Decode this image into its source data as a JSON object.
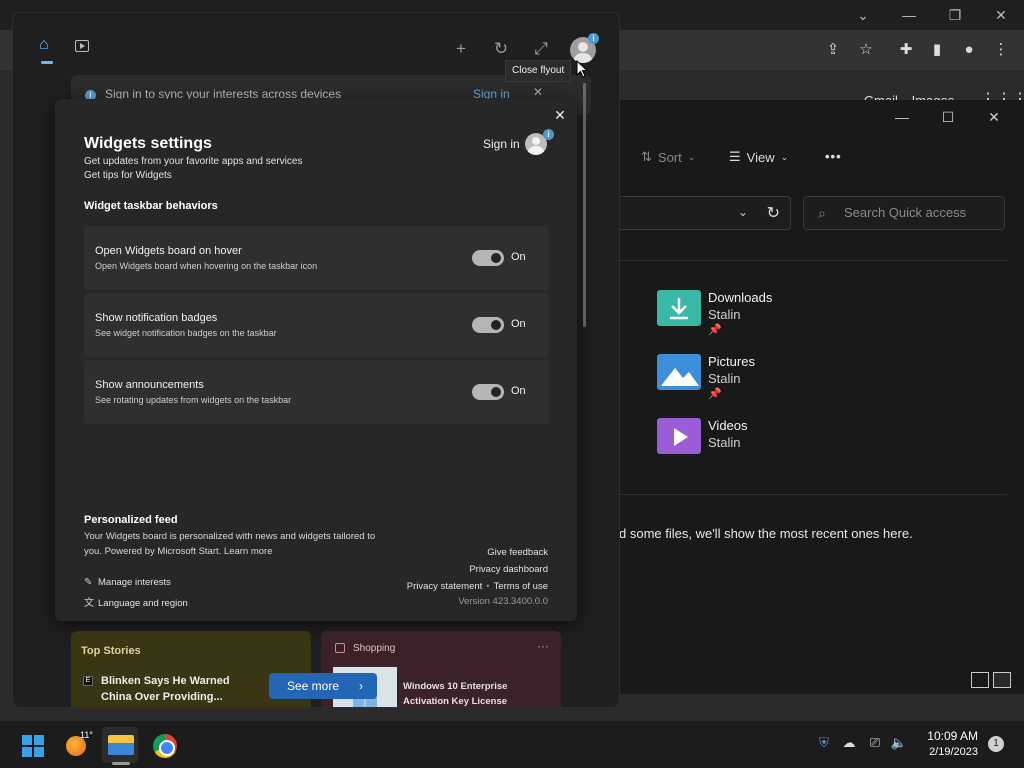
{
  "browser": {
    "google_links": [
      "Gmail",
      "Images"
    ]
  },
  "explorer": {
    "commands": {
      "sort_label": "Sort",
      "view_label": "View",
      "more_label": "•••"
    },
    "search_placeholder": "Search Quick access",
    "quick_access": [
      {
        "name": "Downloads",
        "location": "Stalin",
        "pinned": true,
        "color": "#37b9a6"
      },
      {
        "name": "Pictures",
        "location": "Stalin",
        "pinned": true,
        "color": "#3c8fd8"
      },
      {
        "name": "Videos",
        "location": "Stalin",
        "pinned": false,
        "color": "#9a5dd6"
      }
    ],
    "recent_text": "d some files, we'll show the most recent ones here."
  },
  "widgets": {
    "tooltip": "Close flyout",
    "signin_bar": {
      "text": "Sign in to sync your interests across devices",
      "link": "Sign in",
      "close": "✕"
    },
    "settings": {
      "title": "Widgets settings",
      "subtitle_1": "Get updates from your favorite apps and services",
      "subtitle_2": "Get tips for Widgets",
      "signin_label": "Sign in",
      "section_title": "Widget taskbar behaviors",
      "items": [
        {
          "title": "Open Widgets board on hover",
          "desc": "Open Widgets board when hovering on the taskbar icon",
          "state": "On"
        },
        {
          "title": "Show notification badges",
          "desc": "See widget notification badges on the taskbar",
          "state": "On"
        },
        {
          "title": "Show announcements",
          "desc": "See rotating updates from widgets on the taskbar",
          "state": "On"
        }
      ],
      "feed_title": "Personalized feed",
      "feed_desc": "Your Widgets board is personalized with news and widgets tailored to you. Powered by Microsoft Start.",
      "feed_link": "Learn more",
      "manage_interests": "Manage interests",
      "language_region": "Language and region",
      "give_feedback": "Give feedback",
      "privacy_dashboard": "Privacy dashboard",
      "privacy_statement": "Privacy statement",
      "terms_of_use": "Terms of use",
      "version": "Version 423.3400.0.0"
    },
    "top_stories": {
      "title": "Top Stories",
      "headline": "Blinken Says He Warned China Over Providing..."
    },
    "shopping": {
      "title": "Shopping",
      "more": "···",
      "product": "Windows 10 Enterprise Activation Key License"
    },
    "see_more": "See more"
  },
  "taskbar": {
    "weather_temp": "11°",
    "time": "10:09 AM",
    "date": "2/19/2023",
    "notification_count": "1"
  },
  "colors": {
    "accent": "#6cb8ff",
    "see_more_button": "#2466b6"
  }
}
